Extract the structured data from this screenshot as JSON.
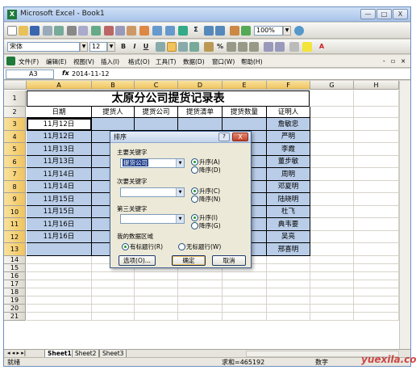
{
  "window": {
    "app_icon": "X",
    "title": "Microsoft Excel - Book1",
    "btn_minimize": "—",
    "btn_maximize": "□",
    "btn_close": "X"
  },
  "toolbar": {
    "zoom": "100%",
    "font_name": "宋体",
    "font_size": "12"
  },
  "menu": {
    "items": [
      "文件(F)",
      "编辑(E)",
      "视图(V)",
      "插入(I)",
      "格式(O)",
      "工具(T)",
      "数据(D)",
      "窗口(W)",
      "帮助(H)"
    ]
  },
  "formula_bar": {
    "name_box": "A3",
    "fx_label": "fx",
    "value": "2014-11-12"
  },
  "columns": [
    "A",
    "B",
    "C",
    "D",
    "E",
    "F",
    "G",
    "H"
  ],
  "rows": [
    "1",
    "2",
    "3",
    "4",
    "5",
    "6",
    "7",
    "8",
    "9",
    "10",
    "11",
    "12",
    "13",
    "14",
    "15",
    "16",
    "17",
    "18",
    "19",
    "20",
    "21"
  ],
  "sheet": {
    "title": "太原分公司提货记录表",
    "headers": [
      "日期",
      "提货人",
      "提货公司",
      "提货清单",
      "提货数量",
      "证明人"
    ],
    "dates": [
      "11月12日",
      "11月12日",
      "11月13日",
      "11月13日",
      "11月14日",
      "11月14日",
      "11月15日",
      "11月15日",
      "11月16日",
      "11月16日"
    ],
    "witnesses": [
      "詹敏忠",
      "严明",
      "李霞",
      "董步敏",
      "周明",
      "邓夏明",
      "陆晓明",
      "杜飞",
      "典韦要",
      "吴亮",
      "邢喜明"
    ]
  },
  "tabs": [
    "Sheet1",
    "Sheet2",
    "Sheet3"
  ],
  "status": {
    "left": "就绪",
    "sum": "求和=465192",
    "right": "数字"
  },
  "dialog": {
    "title": "排序",
    "help": "?",
    "close": "X",
    "primary_label": "主要关键字",
    "primary_value": "提货公司",
    "asc1": "升序(A)",
    "desc1": "降序(D)",
    "secondary_label": "次要关键字",
    "asc2": "升序(C)",
    "desc2": "降序(N)",
    "third_label": "第三关键字",
    "asc3": "升序(I)",
    "desc3": "降序(G)",
    "range_label": "我的数据区域",
    "has_header": "有标题行(R)",
    "no_header": "无标题行(W)",
    "options": "选项(O)...",
    "ok": "确定",
    "cancel": "取消"
  },
  "watermark": "yuexila.com"
}
